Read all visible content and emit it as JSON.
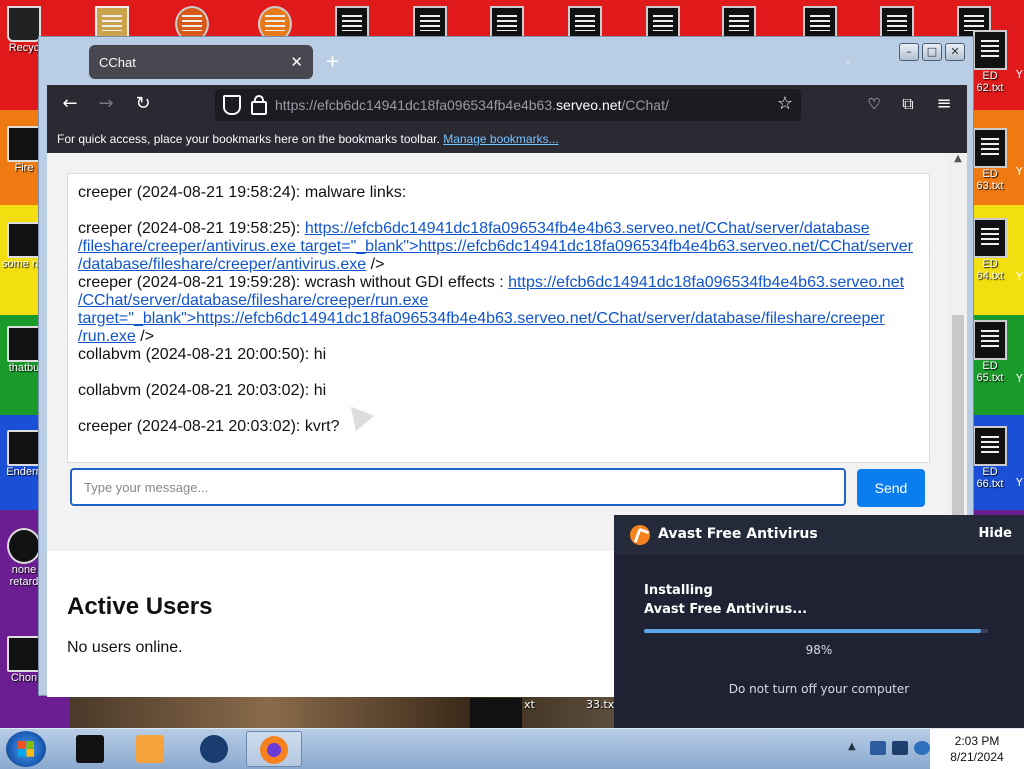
{
  "desktop": {
    "icons": [
      "Recyc",
      "Fire",
      "some ran",
      "thatbu",
      "Endern",
      "none retard",
      "Chon"
    ],
    "right_files": [
      "ED 62.txt",
      "ED 63.txt",
      "ED 64.txt",
      "ED 65.txt",
      "ED 66.txt"
    ],
    "bottom_files": [
      "xt",
      "33.txt"
    ],
    "right_edge": [
      "Y",
      "Y",
      "Y",
      "Y",
      "Y"
    ]
  },
  "browser": {
    "tab_title": "CChat",
    "url_prefix": "https://efcb6dc14941dc18fa096534fb4e4b63.",
    "url_domain": "serveo.net",
    "url_path": "/CChat/",
    "bookmarks_prompt": "For quick access, place your bookmarks here on the bookmarks toolbar.",
    "bookmarks_link": "Manage bookmarks..."
  },
  "chat": {
    "m1": "creeper (2024-08-21 19:58:24): malware links:",
    "m2_prefix": "creeper (2024-08-21 19:58:25): ",
    "m2_link_1": "https://efcb6dc14941dc18fa096534fb4e4b63.serveo.net/CChat/server/database",
    "m2_link_2": "/fileshare/creeper/antivirus.exe target=\"_blank\">https://efcb6dc14941dc18fa096534fb4e4b63.serveo.net/CChat/server",
    "m2_link_3": "/database/fileshare/creeper/antivirus.exe",
    "m2_suffix": " />",
    "m3_prefix": "creeper (2024-08-21 19:59:28): wcrash without GDI effects : ",
    "m3_link_1": "https://efcb6dc14941dc18fa096534fb4e4b63.serveo.net",
    "m3_link_2": "/CChat/server/database/fileshare/creeper/run.exe",
    "m3_link_3": "target=\"_blank\">https://efcb6dc14941dc18fa096534fb4e4b63.serveo.net/CChat/server/database/fileshare/creeper",
    "m3_link_4": "/run.exe",
    "m3_suffix": " />",
    "m4": "collabvm (2024-08-21 20:00:50): hi",
    "m5": "collabvm (2024-08-21 20:03:02): hi",
    "m6": "creeper (2024-08-21 20:03:02): kvrt?",
    "input_placeholder": "Type your message...",
    "send_label": "Send"
  },
  "users": {
    "title": "Active Users",
    "empty_text": "No users online."
  },
  "avast": {
    "title": "Avast Free Antivirus",
    "hide_label": "Hide",
    "status_line1": "Installing",
    "status_line2": "Avast Free Antivirus...",
    "progress": 0.98,
    "progress_text": "98%",
    "note": "Do not turn off your computer",
    "accent_color": "#f5821f"
  },
  "taskbar": {
    "time": "2:03 PM",
    "date": "8/21/2024"
  }
}
